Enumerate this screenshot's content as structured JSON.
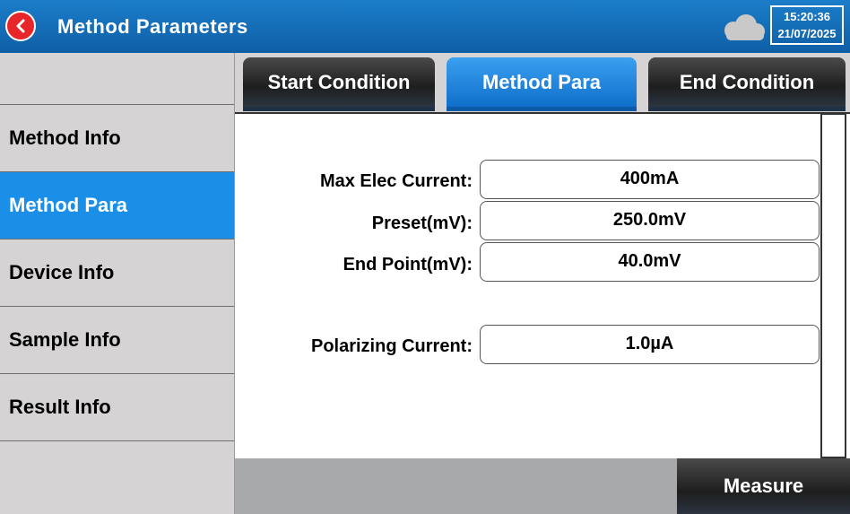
{
  "header": {
    "title": "Method Parameters",
    "time": "15:20:36",
    "date": "21/07/2025",
    "back_icon": "chevron-left-icon",
    "status_icon": "cloud-icon"
  },
  "sidebar": {
    "items": [
      {
        "label": ""
      },
      {
        "label": "Method Info"
      },
      {
        "label": "Method Para"
      },
      {
        "label": "Device Info"
      },
      {
        "label": "Sample Info"
      },
      {
        "label": "Result Info"
      }
    ],
    "active_index": 2
  },
  "tabs": [
    {
      "label": "Start Condition"
    },
    {
      "label": "Method Para"
    },
    {
      "label": "End Condition"
    }
  ],
  "fields": {
    "max_elec_current": {
      "label": "Max Elec Current:",
      "value": "400mA"
    },
    "preset": {
      "label": "Preset(mV):",
      "value": "250.0mV"
    },
    "end_point": {
      "label": "End Point(mV):",
      "value": "40.0mV"
    },
    "polarizing_current": {
      "label": "Polarizing Current:",
      "value": "1.0µA"
    }
  },
  "footer": {
    "measure_label": "Measure"
  },
  "colors": {
    "header_blue": "#1b7dc9",
    "active_blue": "#1b8fe8",
    "back_red": "#e8262a"
  }
}
